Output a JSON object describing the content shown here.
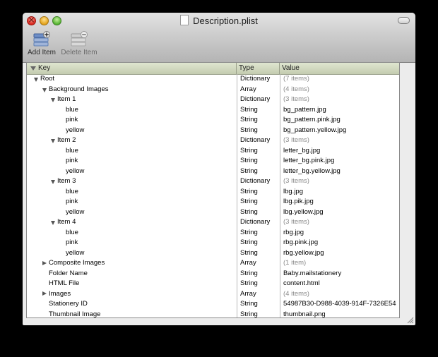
{
  "window": {
    "title": "Description.plist"
  },
  "toolbar": {
    "add_label": "Add Item",
    "delete_label": "Delete Item"
  },
  "columns": {
    "key": "Key",
    "type": "Type",
    "value": "Value"
  },
  "rows": [
    {
      "key": "Root",
      "type": "Dictionary",
      "value": "(7 items)",
      "level": 0,
      "disclosure": "open",
      "dim": true
    },
    {
      "key": "Background Images",
      "type": "Array",
      "value": "(4 items)",
      "level": 1,
      "disclosure": "open",
      "dim": true
    },
    {
      "key": "Item 1",
      "type": "Dictionary",
      "value": "(3 items)",
      "level": 2,
      "disclosure": "open",
      "dim": true
    },
    {
      "key": "blue",
      "type": "String",
      "value": "bg_pattern.jpg",
      "level": 3,
      "disclosure": "none",
      "dim": false
    },
    {
      "key": "pink",
      "type": "String",
      "value": "bg_pattern.pink.jpg",
      "level": 3,
      "disclosure": "none",
      "dim": false
    },
    {
      "key": "yellow",
      "type": "String",
      "value": "bg_pattern.yellow.jpg",
      "level": 3,
      "disclosure": "none",
      "dim": false
    },
    {
      "key": "Item 2",
      "type": "Dictionary",
      "value": "(3 items)",
      "level": 2,
      "disclosure": "open",
      "dim": true
    },
    {
      "key": "blue",
      "type": "String",
      "value": "letter_bg.jpg",
      "level": 3,
      "disclosure": "none",
      "dim": false
    },
    {
      "key": "pink",
      "type": "String",
      "value": "letter_bg.pink.jpg",
      "level": 3,
      "disclosure": "none",
      "dim": false
    },
    {
      "key": "yellow",
      "type": "String",
      "value": "letter_bg.yellow.jpg",
      "level": 3,
      "disclosure": "none",
      "dim": false
    },
    {
      "key": "Item 3",
      "type": "Dictionary",
      "value": "(3 items)",
      "level": 2,
      "disclosure": "open",
      "dim": true
    },
    {
      "key": "blue",
      "type": "String",
      "value": "lbg.jpg",
      "level": 3,
      "disclosure": "none",
      "dim": false
    },
    {
      "key": "pink",
      "type": "String",
      "value": "lbg.pik.jpg",
      "level": 3,
      "disclosure": "none",
      "dim": false
    },
    {
      "key": "yellow",
      "type": "String",
      "value": "lbg.yellow.jpg",
      "level": 3,
      "disclosure": "none",
      "dim": false
    },
    {
      "key": "Item 4",
      "type": "Dictionary",
      "value": "(3 items)",
      "level": 2,
      "disclosure": "open",
      "dim": true
    },
    {
      "key": "blue",
      "type": "String",
      "value": "rbg.jpg",
      "level": 3,
      "disclosure": "none",
      "dim": false
    },
    {
      "key": "pink",
      "type": "String",
      "value": "rbg.pink.jpg",
      "level": 3,
      "disclosure": "none",
      "dim": false
    },
    {
      "key": "yellow",
      "type": "String",
      "value": "rbg.yellow.jpg",
      "level": 3,
      "disclosure": "none",
      "dim": false
    },
    {
      "key": "Composite Images",
      "type": "Array",
      "value": "(1 item)",
      "level": 1,
      "disclosure": "closed",
      "dim": true
    },
    {
      "key": "Folder Name",
      "type": "String",
      "value": "Baby.mailstationery",
      "level": 1,
      "disclosure": "none",
      "dim": false
    },
    {
      "key": "HTML File",
      "type": "String",
      "value": "content.html",
      "level": 1,
      "disclosure": "none",
      "dim": false
    },
    {
      "key": "Images",
      "type": "Array",
      "value": "(4 items)",
      "level": 1,
      "disclosure": "closed",
      "dim": true
    },
    {
      "key": "Stationery ID",
      "type": "String",
      "value": "54987B30-D988-4039-914F-7326E54",
      "level": 1,
      "disclosure": "none",
      "dim": false
    },
    {
      "key": "Thumbnail Image",
      "type": "String",
      "value": "thumbnail.png",
      "level": 1,
      "disclosure": "none",
      "dim": false
    }
  ]
}
